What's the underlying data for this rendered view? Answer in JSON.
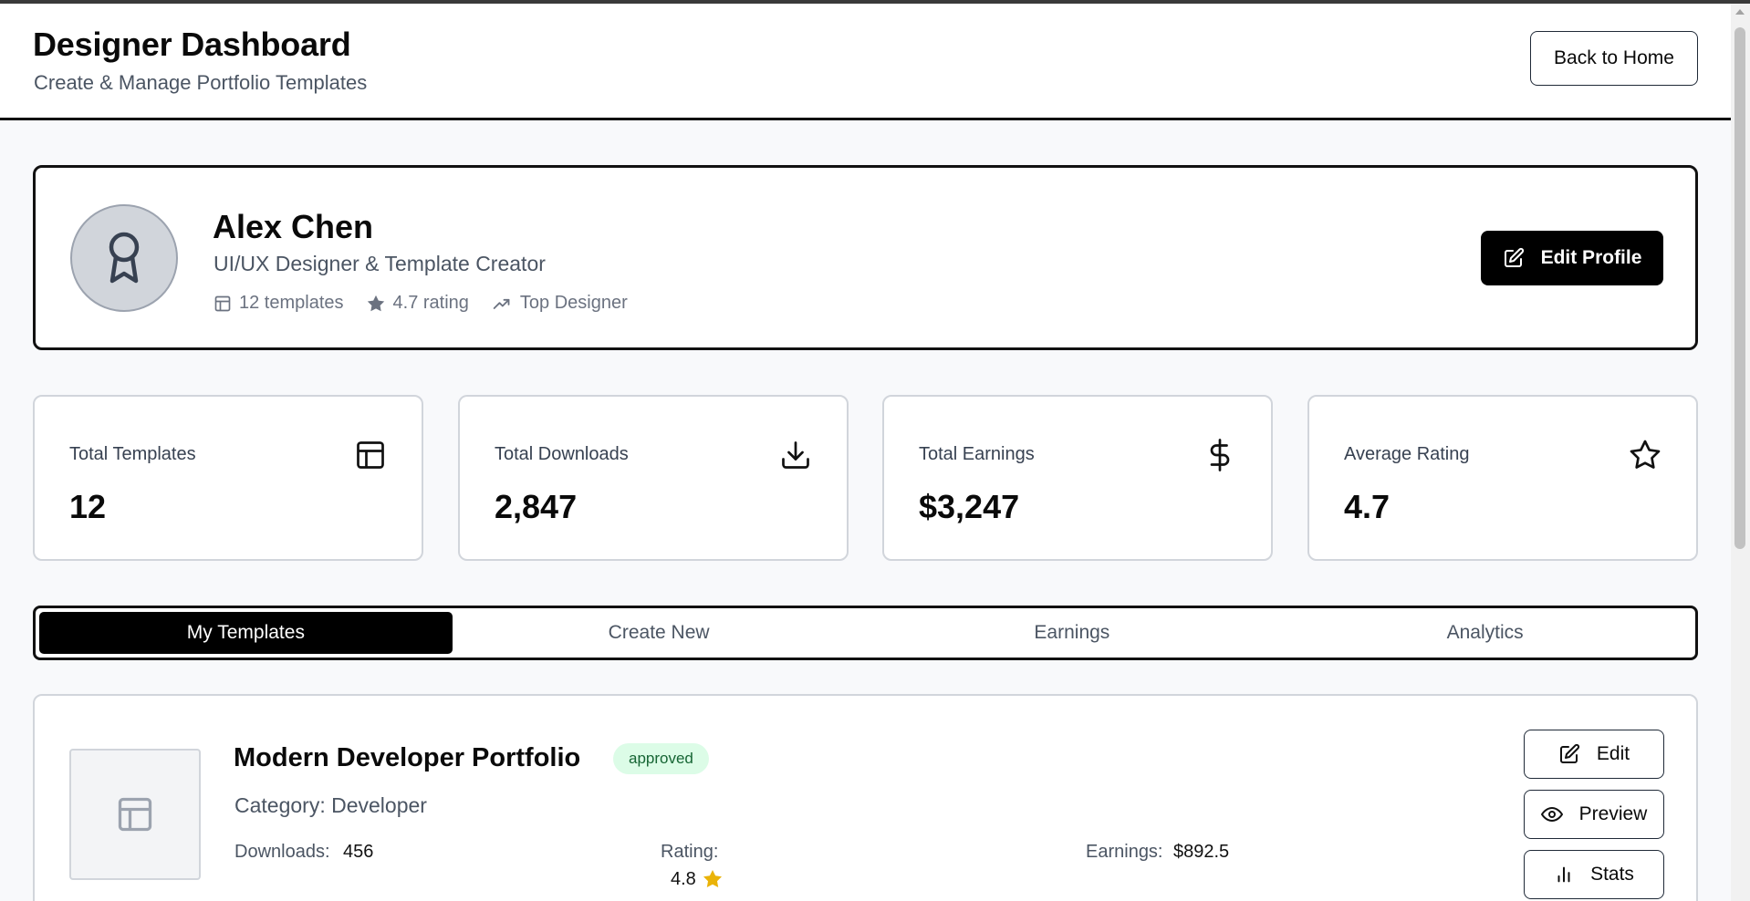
{
  "header": {
    "title": "Designer Dashboard",
    "subtitle": "Create & Manage Portfolio Templates",
    "back_label": "Back to Home"
  },
  "profile": {
    "name": "Alex Chen",
    "role": "UI/UX Designer & Template Creator",
    "templates_meta": "12 templates",
    "rating_meta": "4.7 rating",
    "badge_meta": "Top Designer",
    "edit_label": "Edit Profile"
  },
  "stats": [
    {
      "label": "Total Templates",
      "value": "12",
      "icon": "layout-icon"
    },
    {
      "label": "Total Downloads",
      "value": "2,847",
      "icon": "download-icon"
    },
    {
      "label": "Total Earnings",
      "value": "$3,247",
      "icon": "dollar-icon"
    },
    {
      "label": "Average Rating",
      "value": "4.7",
      "icon": "star-icon"
    }
  ],
  "tabs": [
    {
      "label": "My Templates",
      "active": true
    },
    {
      "label": "Create New",
      "active": false
    },
    {
      "label": "Earnings",
      "active": false
    },
    {
      "label": "Analytics",
      "active": false
    }
  ],
  "template": {
    "title": "Modern Developer Portfolio",
    "status": "approved",
    "category": "Category: Developer",
    "downloads_label": "Downloads:",
    "downloads_value": "456",
    "rating_label": "Rating:",
    "rating_value": "4.8",
    "earnings_label": "Earnings:",
    "earnings_value": "$892.5",
    "edit_label": "Edit",
    "preview_label": "Preview",
    "stats_label": "Stats"
  },
  "colors": {
    "accent": "#000000",
    "approved_bg": "#dcfce7",
    "approved_text": "#166534",
    "star": "#eab308"
  }
}
